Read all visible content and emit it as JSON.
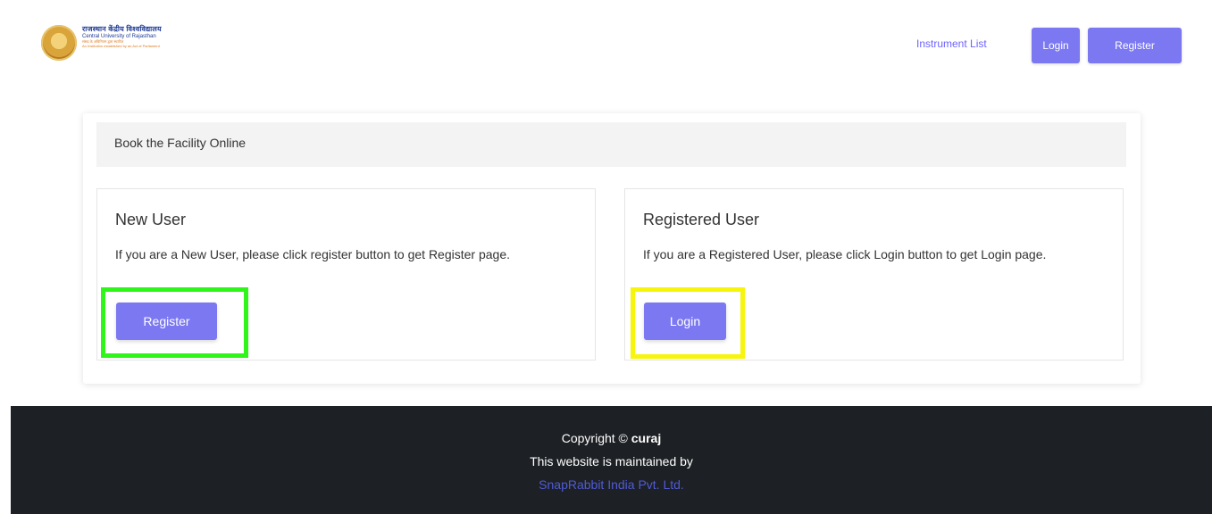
{
  "header": {
    "logo": {
      "line1": "राजस्थान केंद्रीय विश्वविद्यालय",
      "line2": "Central University of Rajasthan",
      "line3": "संसद के अधिनियम द्वारा स्थापित",
      "line4": "An Institution established by an Act of Parliament"
    },
    "nav": {
      "instrument_list": "Instrument List",
      "login": "Login",
      "register": "Register"
    }
  },
  "main": {
    "card_title": "Book the Facility Online",
    "new_user": {
      "title": "New User",
      "text": "If you are a New User, please click register button to get Register page.",
      "button": "Register"
    },
    "registered_user": {
      "title": "Registered User",
      "text": "If you are a Registered User, please click Login button to get Login page.",
      "button": "Login"
    }
  },
  "footer": {
    "copyright_prefix": "Copyright © ",
    "copyright_owner": "curaj",
    "maintained": "This website is maintained by",
    "company": "SnapRabbit India Pvt. Ltd."
  },
  "colors": {
    "accent": "#7b78f2",
    "footer_bg": "#1d2024",
    "highlight_green": "#2ff51a",
    "highlight_yellow": "#f6f50b"
  }
}
